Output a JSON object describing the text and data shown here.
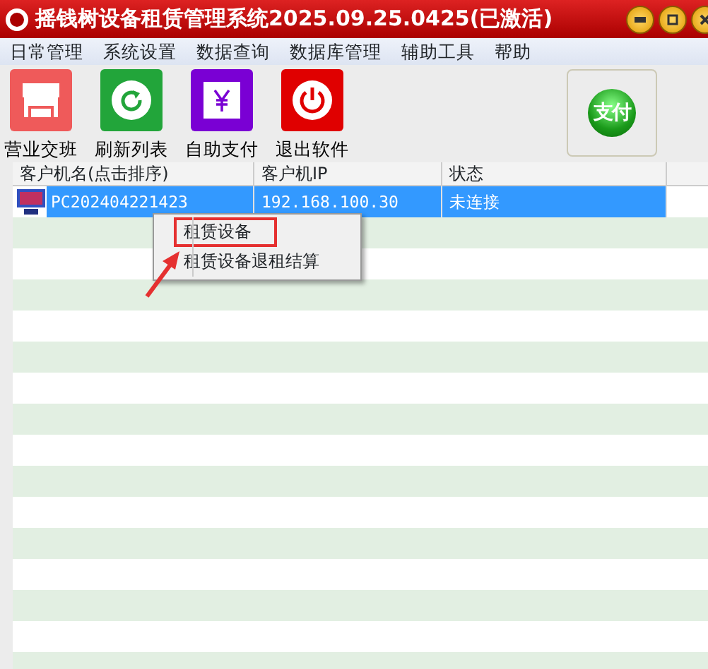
{
  "window": {
    "title": "摇钱树设备租赁管理系统2025.09.25.0425(已激活)"
  },
  "menu": [
    "日常管理",
    "系统设置",
    "数据查询",
    "数据库管理",
    "辅助工具",
    "帮助"
  ],
  "toolbar": [
    {
      "label": "营业交班",
      "kind": "shift",
      "color": "#ef5a5a"
    },
    {
      "label": "刷新列表",
      "kind": "refresh",
      "color": "#22a53a"
    },
    {
      "label": "自助支付",
      "kind": "pay",
      "color": "#7a00d4"
    },
    {
      "label": "退出软件",
      "kind": "exit",
      "color": "#e00000"
    }
  ],
  "pay_badge": {
    "label": "支付"
  },
  "table": {
    "columns": [
      "客户机名(点击排序)",
      "客户机IP",
      "状态"
    ],
    "rows": [
      {
        "cells": [
          "PC202404221423",
          "192.168.100.30",
          "未连接"
        ],
        "selected": true
      }
    ]
  },
  "context_menu": {
    "items": [
      {
        "label": "租赁设备",
        "selected": true
      },
      {
        "label": "租赁设备退租结算",
        "selected": false
      }
    ]
  }
}
